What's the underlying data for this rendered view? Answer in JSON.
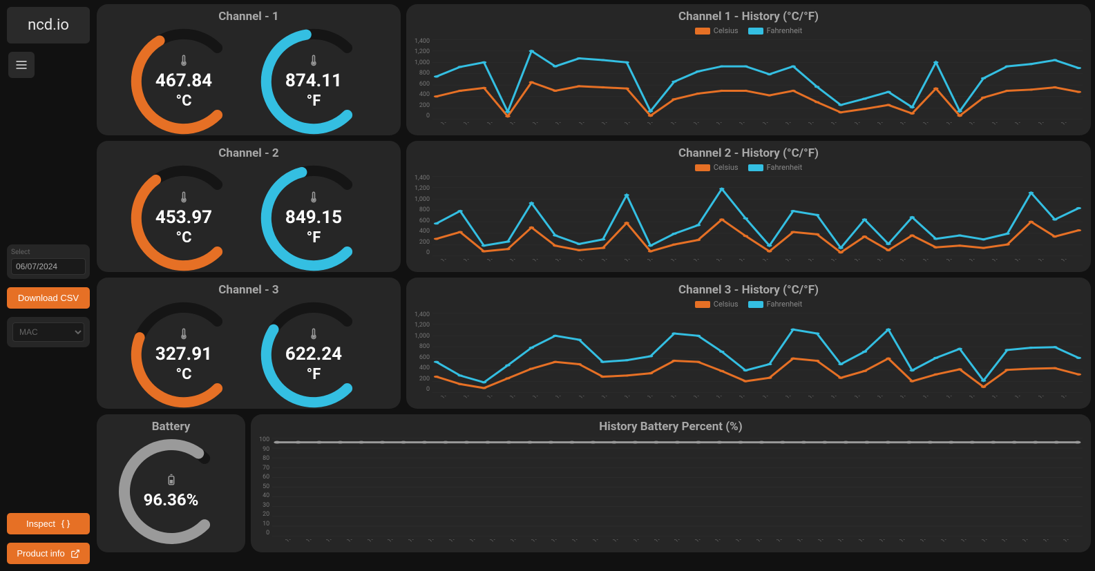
{
  "brand": "ncd.io",
  "sidebar": {
    "date_label": "Select",
    "date_value": "06/07/2024",
    "download_label": "Download CSV",
    "select_placeholder": "MAC",
    "inspect_label": "Inspect",
    "product_info_label": "Product info"
  },
  "colors": {
    "orange": "#e67025",
    "cyan": "#34bfe2",
    "grey": "#9a9a9a"
  },
  "channels": [
    {
      "title": "Channel - 1",
      "celsius": "467.84",
      "fahrenheit": "874.11",
      "unit_c": "°C",
      "unit_f": "°F",
      "pct_c": 0.72,
      "pct_f": 0.8
    },
    {
      "title": "Channel - 2",
      "celsius": "453.97",
      "fahrenheit": "849.15",
      "unit_c": "°C",
      "unit_f": "°F",
      "pct_c": 0.7,
      "pct_f": 0.78
    },
    {
      "title": "Channel - 3",
      "celsius": "327.91",
      "fahrenheit": "622.24",
      "unit_c": "°C",
      "unit_f": "°F",
      "pct_c": 0.58,
      "pct_f": 0.62
    }
  ],
  "battery": {
    "title": "Battery",
    "value": "96.36%",
    "pct": 0.964
  },
  "history_titles": [
    "Channel 1 - History (°C/°F)",
    "Channel 2 - History (°C/°F)",
    "Channel 3 - History (°C/°F)"
  ],
  "legend": {
    "celsius": "Celsius",
    "fahrenheit": "Fahrenheit"
  },
  "chart_data": [
    {
      "type": "line",
      "title": "Channel 1 - History (°C/°F)",
      "ylabel": "",
      "xlabel": "",
      "ylim": [
        0,
        1400
      ],
      "yticks": [
        0,
        200,
        400,
        600,
        800,
        1000,
        1200,
        1400
      ],
      "categories": [
        "15:48:20",
        "15:48:20",
        "15:48:20",
        "15:48:20",
        "15:48:20",
        "15:48:21",
        "15:48:21",
        "15:48:21",
        "15:48:21",
        "15:48:21",
        "15:48:22",
        "15:48:22",
        "15:48:22",
        "15:48:22",
        "15:48:22",
        "15:48:23",
        "15:48:23",
        "15:48:23",
        "15:48:23",
        "15:48:23",
        "15:48:23",
        "15:48:24",
        "15:48:24",
        "15:48:24",
        "15:48:24",
        "15:48:24",
        "15:48:25",
        "15:48:25"
      ],
      "series": [
        {
          "name": "Celsius",
          "color": "#e67025",
          "values": [
            400,
            500,
            550,
            50,
            650,
            500,
            580,
            560,
            540,
            60,
            350,
            450,
            500,
            500,
            420,
            500,
            300,
            120,
            180,
            250,
            100,
            540,
            60,
            380,
            500,
            520,
            560,
            480
          ]
        },
        {
          "name": "Fahrenheit",
          "color": "#34bfe2",
          "values": [
            750,
            920,
            1000,
            130,
            1200,
            930,
            1070,
            1040,
            1000,
            140,
            660,
            840,
            930,
            930,
            790,
            930,
            570,
            250,
            360,
            480,
            210,
            1000,
            140,
            720,
            930,
            970,
            1040,
            900
          ]
        }
      ]
    },
    {
      "type": "line",
      "title": "Channel 2 - History (°C/°F)",
      "ylabel": "",
      "xlabel": "",
      "ylim": [
        0,
        1400
      ],
      "yticks": [
        0,
        200,
        400,
        600,
        800,
        1000,
        1200,
        1400
      ],
      "categories": [
        "15:48:20",
        "15:48:20",
        "15:48:20",
        "15:48:20",
        "15:48:20",
        "15:48:21",
        "15:48:21",
        "15:48:21",
        "15:48:21",
        "15:48:21",
        "15:48:22",
        "15:48:22",
        "15:48:22",
        "15:48:22",
        "15:48:22",
        "15:48:23",
        "15:48:23",
        "15:48:23",
        "15:48:23",
        "15:48:23",
        "15:48:23",
        "15:48:24",
        "15:48:24",
        "15:48:24",
        "15:48:24",
        "15:48:24",
        "15:48:25",
        "15:48:25"
      ],
      "series": [
        {
          "name": "Celsius",
          "color": "#e67025",
          "values": [
            300,
            420,
            80,
            120,
            500,
            180,
            100,
            140,
            580,
            80,
            200,
            280,
            640,
            350,
            80,
            420,
            380,
            60,
            340,
            100,
            360,
            150,
            180,
            140,
            200,
            600,
            340,
            450
          ]
        },
        {
          "name": "Fahrenheit",
          "color": "#34bfe2",
          "values": [
            570,
            790,
            180,
            250,
            930,
            360,
            210,
            290,
            1070,
            180,
            390,
            540,
            1180,
            660,
            180,
            790,
            720,
            140,
            640,
            210,
            680,
            300,
            360,
            290,
            390,
            1110,
            640,
            840
          ]
        }
      ]
    },
    {
      "type": "line",
      "title": "Channel 3 - History (°C/°F)",
      "ylabel": "",
      "xlabel": "",
      "ylim": [
        0,
        1400
      ],
      "yticks": [
        0,
        200,
        400,
        600,
        800,
        1000,
        1200,
        1400
      ],
      "categories": [
        "15:48:20",
        "15:48:20",
        "15:48:20",
        "15:48:20",
        "15:48:20",
        "15:48:21",
        "15:48:21",
        "15:48:21",
        "15:48:21",
        "15:48:21",
        "15:48:22",
        "15:48:22",
        "15:48:22",
        "15:48:22",
        "15:48:22",
        "15:48:23",
        "15:48:23",
        "15:48:23",
        "15:48:23",
        "15:48:23",
        "15:48:23",
        "15:48:24",
        "15:48:24",
        "15:48:24",
        "15:48:24",
        "15:48:24",
        "15:48:25",
        "15:48:25"
      ],
      "series": [
        {
          "name": "Celsius",
          "color": "#e67025",
          "values": [
            280,
            150,
            80,
            250,
            420,
            540,
            500,
            280,
            300,
            340,
            560,
            540,
            380,
            200,
            260,
            600,
            560,
            260,
            380,
            600,
            200,
            320,
            410,
            100,
            400,
            420,
            430,
            320
          ]
        },
        {
          "name": "Fahrenheit",
          "color": "#34bfe2",
          "values": [
            540,
            300,
            180,
            480,
            790,
            1000,
            930,
            540,
            570,
            640,
            1040,
            1000,
            720,
            390,
            500,
            1110,
            1040,
            500,
            720,
            1110,
            390,
            610,
            770,
            210,
            750,
            790,
            800,
            610
          ]
        }
      ]
    }
  ],
  "battery_history": {
    "title": "History Battery Percent (%)",
    "type": "line",
    "ylim": [
      0,
      100
    ],
    "yticks": [
      0,
      10,
      20,
      30,
      40,
      50,
      60,
      70,
      80,
      90,
      100
    ],
    "categories": [
      "15:48:20",
      "15:48:20",
      "15:48:20",
      "15:48:20",
      "15:48:20",
      "15:48:20",
      "15:48:20",
      "15:48:21",
      "15:48:21",
      "15:48:21",
      "15:48:21",
      "15:48:21",
      "15:48:21",
      "15:48:22",
      "15:48:22",
      "15:48:22",
      "15:48:22",
      "15:48:22",
      "15:48:22",
      "15:48:22",
      "15:48:23",
      "15:48:23",
      "15:48:23",
      "15:48:23",
      "15:48:23",
      "15:48:23",
      "15:48:23",
      "15:48:24",
      "15:48:24",
      "15:48:24",
      "15:48:24",
      "15:48:24",
      "15:48:24",
      "15:48:24",
      "15:48:25",
      "15:48:25",
      "15:48:25",
      "15:48:25",
      "15:48:25"
    ],
    "series": [
      {
        "name": "Battery",
        "color": "#9a9a9a",
        "values": [
          96,
          96,
          96,
          96,
          96,
          96,
          96,
          96,
          96,
          96,
          96,
          96,
          96,
          96,
          96,
          96,
          96,
          96,
          96,
          96,
          96,
          96,
          96,
          96,
          96,
          96,
          96,
          96,
          96,
          96,
          96,
          96,
          96,
          96,
          96,
          96,
          96,
          96,
          96
        ]
      }
    ]
  }
}
